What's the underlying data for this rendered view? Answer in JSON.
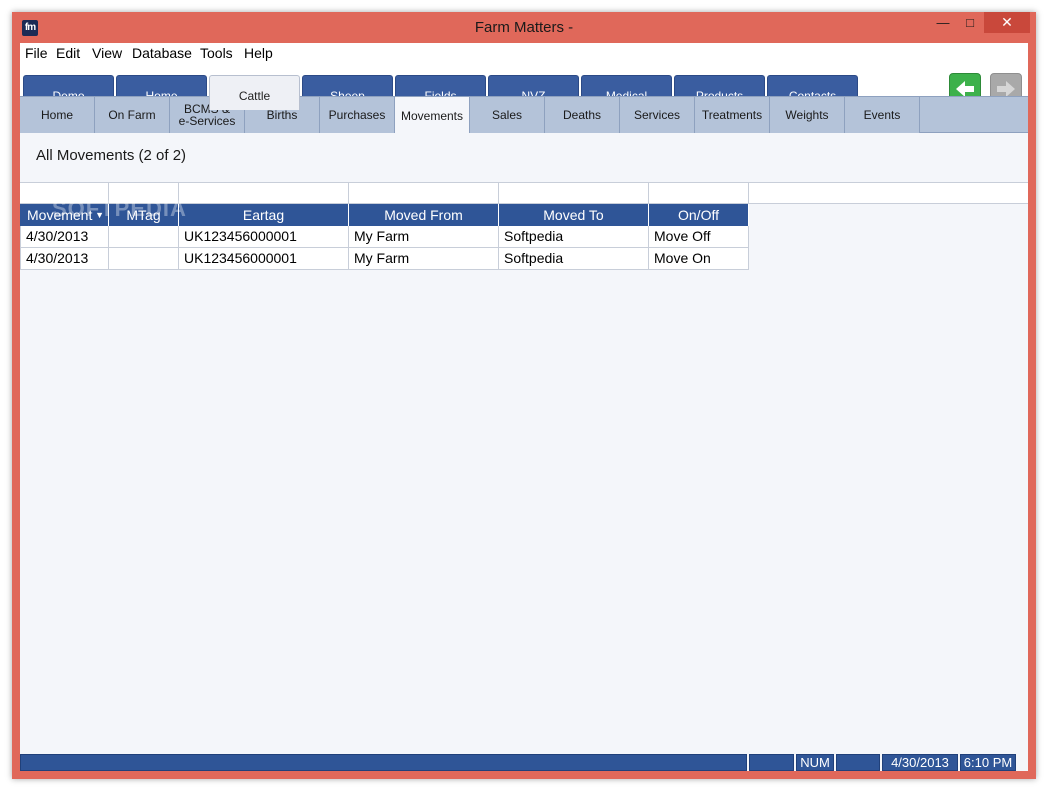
{
  "window": {
    "title": "Farm Matters -",
    "icon_text": "fm",
    "minimize": "—",
    "maximize": "□",
    "close": "✕"
  },
  "menu": {
    "file": "File",
    "edit": "Edit",
    "view": "View",
    "database": "Database",
    "tools": "Tools",
    "help": "Help"
  },
  "top_tabs": [
    {
      "label": "Demo"
    },
    {
      "label": "Home"
    },
    {
      "label": "Cattle"
    },
    {
      "label": "Sheep"
    },
    {
      "label": "Fields"
    },
    {
      "label": "NVZ"
    },
    {
      "label": "Medical"
    },
    {
      "label": "Products"
    },
    {
      "label": "Contacts"
    }
  ],
  "active_top_tab": "Cattle",
  "nav": {
    "back_icon": "arrow-left-icon",
    "forward_icon": "arrow-right-icon"
  },
  "sub_tabs": [
    {
      "label": "Home"
    },
    {
      "label": "On Farm"
    },
    {
      "label": "BCMS &\ne-Services"
    },
    {
      "label": "Births"
    },
    {
      "label": "Purchases"
    },
    {
      "label": "Movements"
    },
    {
      "label": "Sales"
    },
    {
      "label": "Deaths"
    },
    {
      "label": "Services"
    },
    {
      "label": "Treatments"
    },
    {
      "label": "Weights"
    },
    {
      "label": "Events"
    }
  ],
  "active_sub_tab": "Movements",
  "section": {
    "title": "All Movements (2 of 2)"
  },
  "table": {
    "columns": [
      "Movement",
      "MTag",
      "Eartag",
      "Moved From",
      "Moved To",
      "On/Off"
    ],
    "sort_indicator": "▼",
    "rows": [
      [
        "4/30/2013",
        "",
        "UK123456000001",
        "My Farm",
        "Softpedia",
        "Move Off"
      ],
      [
        "4/30/2013",
        "",
        "UK123456000001",
        "My Farm",
        "Softpedia",
        "Move On"
      ]
    ]
  },
  "watermark": "SOFTPEDIA",
  "status": {
    "num": "NUM",
    "date": "4/30/2013",
    "time": "6:10 PM"
  },
  "colors": {
    "frame": "#e0685a",
    "tab_blue": "#3a5da0",
    "header_blue": "#2f5597",
    "subtab_bg": "#b4c3d9",
    "back_green": "#3db14b"
  }
}
